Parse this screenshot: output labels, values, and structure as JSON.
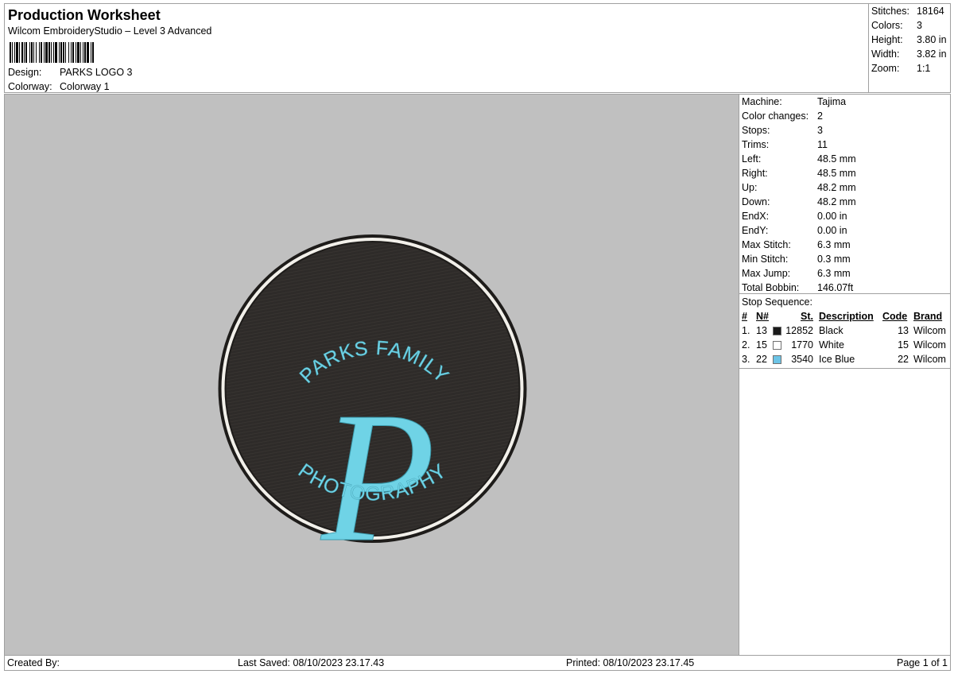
{
  "header": {
    "title": "Production Worksheet",
    "subtitle": "Wilcom EmbroideryStudio – Level 3 Advanced",
    "design_label": "Design:",
    "design_value": "PARKS LOGO 3",
    "colorway_label": "Colorway:",
    "colorway_value": "Colorway 1"
  },
  "summary": {
    "stitches_label": "Stitches:",
    "stitches": "18164",
    "colors_label": "Colors:",
    "colors": "3",
    "height_label": "Height:",
    "height": "3.80 in",
    "width_label": "Width:",
    "width": "3.82 in",
    "zoom_label": "Zoom:",
    "zoom": "1:1"
  },
  "info": [
    {
      "label": "Machine:",
      "value": "Tajima"
    },
    {
      "label": "Color changes:",
      "value": "2"
    },
    {
      "label": "Stops:",
      "value": "3"
    },
    {
      "label": "Trims:",
      "value": "11"
    },
    {
      "label": "Left:",
      "value": "48.5 mm"
    },
    {
      "label": "Right:",
      "value": "48.5 mm"
    },
    {
      "label": "Up:",
      "value": "48.2 mm"
    },
    {
      "label": "Down:",
      "value": "48.2 mm"
    },
    {
      "label": "EndX:",
      "value": "0.00 in"
    },
    {
      "label": "EndY:",
      "value": "0.00 in"
    },
    {
      "label": "Max Stitch:",
      "value": "6.3 mm"
    },
    {
      "label": "Min Stitch:",
      "value": "0.3 mm"
    },
    {
      "label": "Max Jump:",
      "value": "6.3 mm"
    },
    {
      "label": "Total Bobbin:",
      "value": "146.07ft"
    }
  ],
  "stop_sequence": {
    "title": "Stop Sequence:",
    "headers": {
      "num": "#",
      "needle": "N#",
      "stitches": "St.",
      "description": "Description",
      "code": "Code",
      "brand": "Brand"
    },
    "rows": [
      {
        "num": "1.",
        "needle": "13",
        "color": "#1a1a1a",
        "stitches": "12852",
        "description": "Black",
        "code": "13",
        "brand": "Wilcom"
      },
      {
        "num": "2.",
        "needle": "15",
        "color": "#ffffff",
        "stitches": "1770",
        "description": "White",
        "code": "15",
        "brand": "Wilcom"
      },
      {
        "num": "3.",
        "needle": "22",
        "color": "#6cc4e6",
        "stitches": "3540",
        "description": "Ice Blue",
        "code": "22",
        "brand": "Wilcom"
      }
    ]
  },
  "design": {
    "top_text": "PARKS FAMILY",
    "monogram": "P",
    "bottom_text": "PHOTOGRAPHY"
  },
  "footer": {
    "created_by": "Created By:",
    "last_saved": "Last Saved: 08/10/2023 23.17.43",
    "printed": "Printed: 08/10/2023 23.17.45",
    "page": "Page 1 of 1"
  }
}
